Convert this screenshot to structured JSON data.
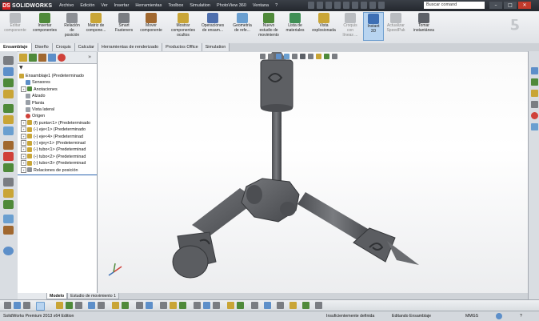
{
  "app": {
    "logo_mark": "DS",
    "logo_text": "SOLIDWORKS"
  },
  "menu": [
    "Archivo",
    "Edición",
    "Ver",
    "Insertar",
    "Herramientas",
    "Toolbox",
    "Simulation",
    "PhotoView 360",
    "Ventana",
    "?"
  ],
  "search": {
    "placeholder": "Buscar comand"
  },
  "window_controls": [
    "–",
    "□",
    "✕"
  ],
  "commands": [
    {
      "label": "Editar\ncomponente",
      "icon": "edit-component-icon",
      "enabled": false
    },
    {
      "label": "Insertar\ncomponentes",
      "icon": "insert-components-icon",
      "enabled": true
    },
    {
      "label": "Relación\nde\nposición",
      "icon": "mate-icon",
      "enabled": true
    },
    {
      "label": "Matriz de\ncompone...",
      "icon": "pattern-icon",
      "enabled": true
    },
    {
      "label": "Smart\nFasteners",
      "icon": "smart-fasteners-icon",
      "enabled": true
    },
    {
      "label": "Mover\ncomponente",
      "icon": "move-component-icon",
      "enabled": true
    },
    {
      "label": "Mostrar\ncomponentes\nocultos",
      "icon": "show-hidden-icon",
      "enabled": true
    },
    {
      "label": "Operaciones\nde ensam...",
      "icon": "assembly-features-icon",
      "enabled": true
    },
    {
      "label": "Geometría\nde refe...",
      "icon": "reference-geometry-icon",
      "enabled": true
    },
    {
      "label": "Nuevo\nestudio de\nmovimiento",
      "icon": "motion-study-icon",
      "enabled": true
    },
    {
      "label": "Lista de\nmateriales",
      "icon": "bom-icon",
      "enabled": true
    },
    {
      "label": "Vista\nexplosionada",
      "icon": "exploded-view-icon",
      "enabled": true
    },
    {
      "label": "Croquis\ncon\nlíneas ...",
      "icon": "explode-line-icon",
      "enabled": false
    },
    {
      "label": "Instant\n3D",
      "icon": "instant3d-icon",
      "enabled": true,
      "active": true
    },
    {
      "label": "Actualizar\nSpeedPak",
      "icon": "speedpak-icon",
      "enabled": false
    },
    {
      "label": "Tomar\ninstantánea",
      "icon": "snapshot-icon",
      "enabled": true
    }
  ],
  "tabs": [
    "Ensamblaje",
    "Diseño",
    "Croquis",
    "Calcular",
    "Herramientas de renderizado",
    "Productos Office",
    "Simulation"
  ],
  "tree": [
    {
      "label": "Ensamblaje1  (Predeterminado",
      "expander": "",
      "icon": "assembly-icon",
      "indent": 0
    },
    {
      "label": "Sensores",
      "expander": "",
      "icon": "sensors-icon",
      "indent": 1
    },
    {
      "label": "Anotaciones",
      "expander": "+",
      "icon": "annotations-icon",
      "indent": 1
    },
    {
      "label": "Alzado",
      "expander": "",
      "icon": "plane-icon",
      "indent": 1
    },
    {
      "label": "Planta",
      "expander": "",
      "icon": "plane-icon",
      "indent": 1
    },
    {
      "label": "Vista lateral",
      "expander": "",
      "icon": "plane-icon",
      "indent": 1
    },
    {
      "label": "Origen",
      "expander": "",
      "icon": "origin-icon",
      "indent": 1
    },
    {
      "label": "(f) punta<1> (Predeterminado",
      "expander": "+",
      "icon": "part-icon",
      "indent": 1
    },
    {
      "label": "(-) eje<1> (Predeterminado",
      "expander": "+",
      "icon": "part-icon",
      "indent": 1
    },
    {
      "label": "(-) eje<4> (Predeterminad",
      "expander": "+",
      "icon": "part-icon",
      "indent": 1
    },
    {
      "label": "(-) ejey<1> (Predeterminad",
      "expander": "+",
      "icon": "part-icon",
      "indent": 1
    },
    {
      "label": "(-) tubo<1> (Predeterminad",
      "expander": "+",
      "icon": "part-icon",
      "indent": 1
    },
    {
      "label": "(-) tubo<2> (Predeterminad",
      "expander": "+",
      "icon": "part-icon",
      "indent": 1
    },
    {
      "label": "(-) tubo<3> (Predeterminad",
      "expander": "+",
      "icon": "part-icon",
      "indent": 1
    },
    {
      "label": "Relaciones de posición",
      "expander": "+",
      "icon": "mates-folder-icon",
      "indent": 0
    }
  ],
  "bottom_tabs": [
    "Modelo",
    "Estudio de movimiento 1"
  ],
  "status": {
    "edition": "SolidWorks Premium 2013 x64 Edition",
    "definition": "Insuficientemente definida",
    "mode": "Editando Ensamblaje",
    "units": "MMGS",
    "help": "?"
  },
  "colors": {
    "accent": "#d81e1e",
    "model": "#5d5f63",
    "titlebar": "#2c3037",
    "selection": "#b8d4f0"
  }
}
